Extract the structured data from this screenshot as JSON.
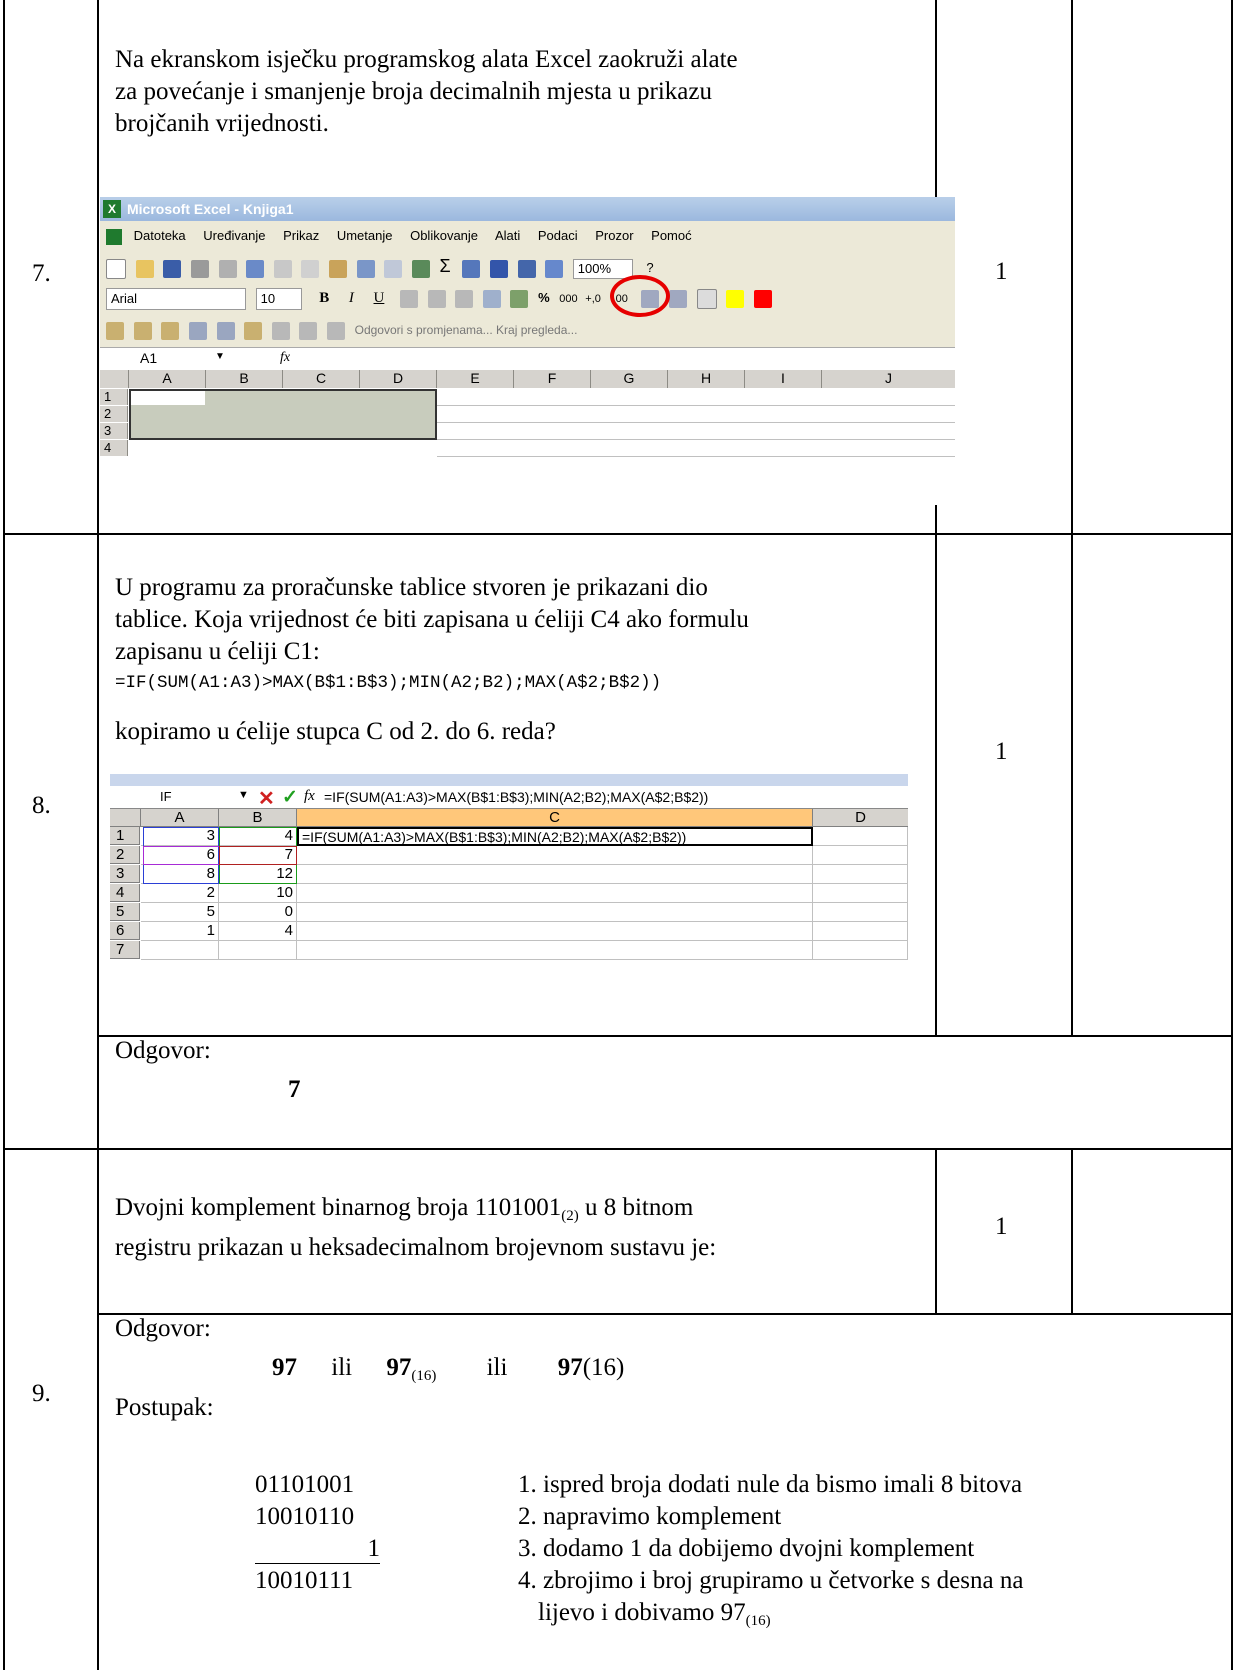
{
  "rows": [
    {
      "number": "7.",
      "points": "1"
    },
    {
      "number": "8.",
      "points": "1"
    },
    {
      "number": "9.",
      "points": "1"
    }
  ],
  "q7": {
    "text_lines": [
      "Na ekranskom isječku programskog alata Excel zaokruži alate",
      "za povećanje i smanjenje broja decimalnih mjesta u prikazu",
      "brojčanih vrijednosti."
    ],
    "excel": {
      "title": "Microsoft Excel - Knjiga1",
      "menu": [
        "Datoteka",
        "Uređivanje",
        "Prikaz",
        "Umetanje",
        "Oblikovanje",
        "Alati",
        "Podaci",
        "Prozor",
        "Pomoć"
      ],
      "zoom": "100%",
      "font": "Arial",
      "font_size": "10",
      "review_text": "Odgovori s promjenama...  Kraj pregleda...",
      "name_box": "A1",
      "fx": "fx",
      "columns": [
        "A",
        "B",
        "C",
        "D",
        "E",
        "F",
        "G",
        "H",
        "I",
        "J"
      ],
      "rows": [
        "1",
        "2",
        "3",
        "4"
      ],
      "highlight_color": "#e60000"
    }
  },
  "q8": {
    "text_lines": [
      "U programu za proračunske tablice stvoren je prikazani dio",
      "tablice. Koja vrijednost će biti zapisana u ćeliji C4 ako formulu",
      "zapisanu u ćeliji C1:"
    ],
    "formula": "=IF(SUM(A1:A3)>MAX(B$1:B$3);MIN(A2;B2);MAX(A$2;B$2))",
    "after_formula": "kopiramo u ćelije stupca C od 2. do 6. reda?",
    "excel": {
      "name_box": "IF",
      "formula_bar": "=IF(SUM(A1:A3)>MAX(B$1:B$3);MIN(A2;B2);MAX(A$2;B$2))",
      "columns": [
        "A",
        "B",
        "C",
        "D"
      ],
      "row_numbers": [
        "1",
        "2",
        "3",
        "4",
        "5",
        "6",
        "7"
      ],
      "col_a": [
        "3",
        "6",
        "8",
        "2",
        "5",
        "1",
        ""
      ],
      "col_b": [
        "4",
        "7",
        "12",
        "10",
        "0",
        "4",
        ""
      ],
      "c1": "=IF(SUM(A1:A3)>MAX(B$1:B$3);MIN(A2;B2);MAX(A$2;B$2))",
      "selected_column_color": "#ffc77a"
    },
    "answer_label": "Odgovor:",
    "answer": "7"
  },
  "q9": {
    "text_line1_a": "Dvojni komplement binarnog broja 1101001",
    "text_line1_sub": "(2)",
    "text_line1_b": " u 8 bitnom",
    "text_line2": "registru prikazan u heksadecimalnom brojevnom sustavu je:",
    "answer_label": "Odgovor:",
    "answer_a": "97",
    "answer_or": "ili",
    "answer_b": "97",
    "answer_b_sub": "(16)",
    "answer_c": "97",
    "answer_c_suffix": "(16)",
    "procedure_label": "Postupak:",
    "binary": [
      "01101001",
      "10010110",
      "1",
      "10010111"
    ],
    "steps": [
      "1.  ispred broja dodati  nule da bismo imali 8 bitova",
      "2. napravimo komplement",
      "3. dodamo 1 da dobijemo dvojni komplement",
      "4. zbrojimo i broj grupiramo u četvorke s desna na"
    ],
    "step4_cont": "lijevo i dobivamo 97",
    "step4_sub": "(16)"
  }
}
